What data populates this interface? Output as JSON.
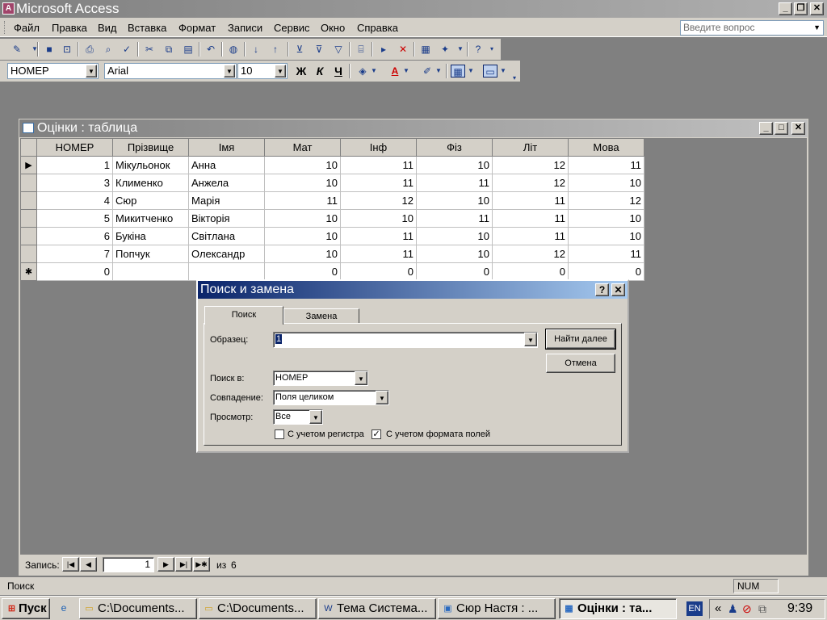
{
  "app": {
    "title": "Microsoft Access"
  },
  "menu": {
    "items": [
      "Файл",
      "Правка",
      "Вид",
      "Вставка",
      "Формат",
      "Записи",
      "Сервис",
      "Окно",
      "Справка"
    ],
    "ask_placeholder": "Введите вопрос"
  },
  "format_toolbar": {
    "object": "НОМЕР",
    "font": "Arial",
    "size": "10",
    "bold": "Ж",
    "italic": "К",
    "underline": "Ч"
  },
  "table_window": {
    "title": "Оцінки : таблица",
    "columns": [
      "НОМЕР",
      "Прізвище",
      "Імя",
      "Мат",
      "Інф",
      "Фіз",
      "Літ",
      "Мова"
    ],
    "rows": [
      [
        "1",
        "Мікульонок",
        "Анна",
        "10",
        "11",
        "10",
        "12",
        "11"
      ],
      [
        "3",
        "Клименко",
        "Анжела",
        "10",
        "11",
        "11",
        "12",
        "10"
      ],
      [
        "4",
        "Сюр",
        "Марія",
        "11",
        "12",
        "10",
        "11",
        "12"
      ],
      [
        "5",
        "Микитченко",
        "Вікторія",
        "10",
        "10",
        "11",
        "11",
        "10"
      ],
      [
        "6",
        "Букіна",
        "Світлана",
        "10",
        "11",
        "10",
        "11",
        "10"
      ],
      [
        "7",
        "Попчук",
        "Олександр",
        "10",
        "11",
        "10",
        "12",
        "11"
      ]
    ],
    "new_row": [
      "0",
      "",
      "",
      "0",
      "0",
      "0",
      "0",
      "0"
    ],
    "current_marker": "▶",
    "new_marker": "✱",
    "nav": {
      "label": "Запись:",
      "current": "1",
      "of_label": "из",
      "total": "6"
    }
  },
  "dialog": {
    "title": "Поиск и замена",
    "help": "?",
    "close": "✕",
    "tabs": [
      "Поиск",
      "Замена"
    ],
    "find_label": "Образец:",
    "find_value": "1",
    "find_next": "Найти далее",
    "cancel": "Отмена",
    "look_in_label": "Поиск в:",
    "look_in_value": "НОМЕР",
    "match_label": "Совпадение:",
    "match_value": "Поля целиком",
    "search_label": "Просмотр:",
    "search_value": "Все",
    "match_case": "С учетом регистра",
    "match_case_checked": false,
    "format_label": "С учетом формата полей",
    "format_checked": true
  },
  "status": {
    "text": "Поиск",
    "num": "NUM"
  },
  "taskbar": {
    "start": "Пуск",
    "tasks": [
      "C:\\Documents...",
      "C:\\Documents...",
      "Тема Система...",
      "Сюр Настя : ...",
      "Оцінки : та..."
    ],
    "lang": "EN",
    "time": "9:39",
    "chevron": "«"
  },
  "colors": {
    "titlebar_active": "#0a246a",
    "face": "#d4d0c8",
    "workspace": "#808080"
  }
}
